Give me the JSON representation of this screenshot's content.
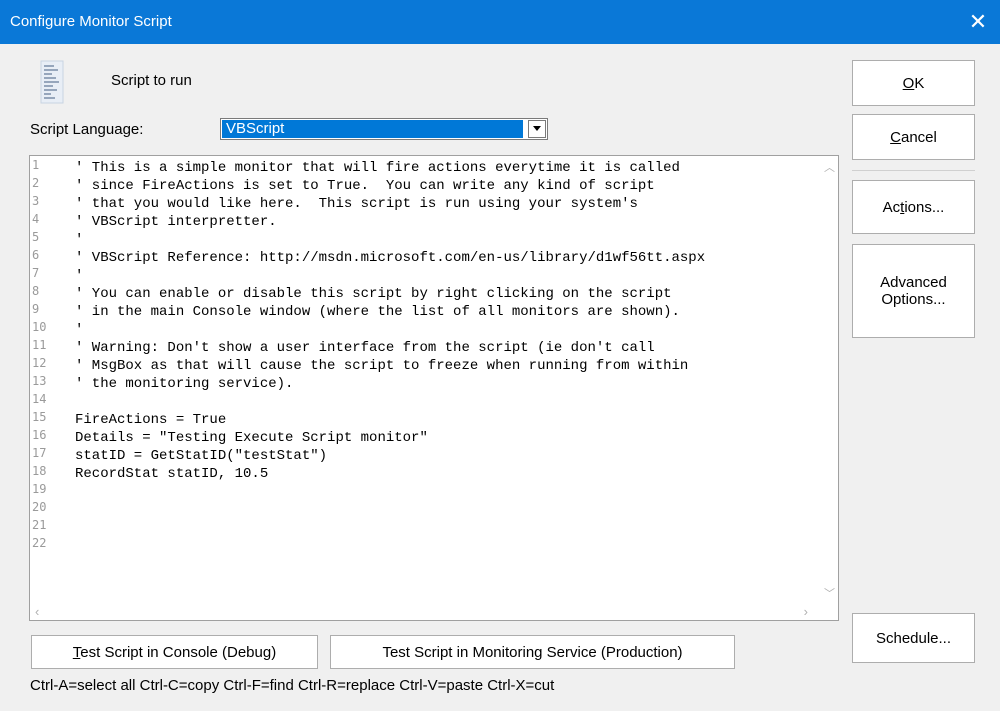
{
  "window": {
    "title": "Configure Monitor Script",
    "close_glyph": "✕"
  },
  "header": {
    "icon": "script-document-icon",
    "label": "Script to run"
  },
  "language": {
    "label": "Script Language:",
    "value": "VBScript"
  },
  "editor": {
    "line_numbers": [
      "1",
      "2",
      "3",
      "4",
      "5",
      "6",
      "7",
      "8",
      "9",
      "10",
      "11",
      "12",
      "13",
      "14",
      "15",
      "16",
      "17",
      "18",
      "19",
      "20",
      "21",
      "22"
    ],
    "lines": [
      "' This is a simple monitor that will fire actions everytime it is called",
      "' since FireActions is set to True.  You can write any kind of script",
      "' that you would like here.  This script is run using your system's",
      "' VBScript interpretter.",
      "'",
      "' VBScript Reference: http://msdn.microsoft.com/en-us/library/d1wf56tt.aspx",
      "'",
      "' You can enable or disable this script by right clicking on the script",
      "' in the main Console window (where the list of all monitors are shown).",
      "'",
      "' Warning: Don't show a user interface from the script (ie don't call",
      "' MsgBox as that will cause the script to freeze when running from within",
      "' the monitoring service).",
      "",
      "FireActions = True",
      "Details = \"Testing Execute Script monitor\"",
      "statID = GetStatID(\"testStat\")",
      "RecordStat statID, 10.5",
      "",
      "",
      "",
      ""
    ]
  },
  "buttons": {
    "ok": {
      "pre": "",
      "key": "O",
      "post": "K"
    },
    "cancel": {
      "pre": "",
      "key": "C",
      "post": "ancel"
    },
    "actions": {
      "pre": "Ac",
      "key": "t",
      "post": "ions..."
    },
    "advanced": {
      "line1": "Advanced",
      "line2": "Options..."
    },
    "schedule": {
      "label": "Schedule..."
    },
    "test_console": {
      "pre": "",
      "key": "T",
      "post": "est Script in Console (Debug)"
    },
    "test_service": {
      "label": "Test Script in Monitoring Service (Production)"
    }
  },
  "shortcuts": "Ctrl-A=select all  Ctrl-C=copy  Ctrl-F=find  Ctrl-R=replace  Ctrl-V=paste  Ctrl-X=cut"
}
